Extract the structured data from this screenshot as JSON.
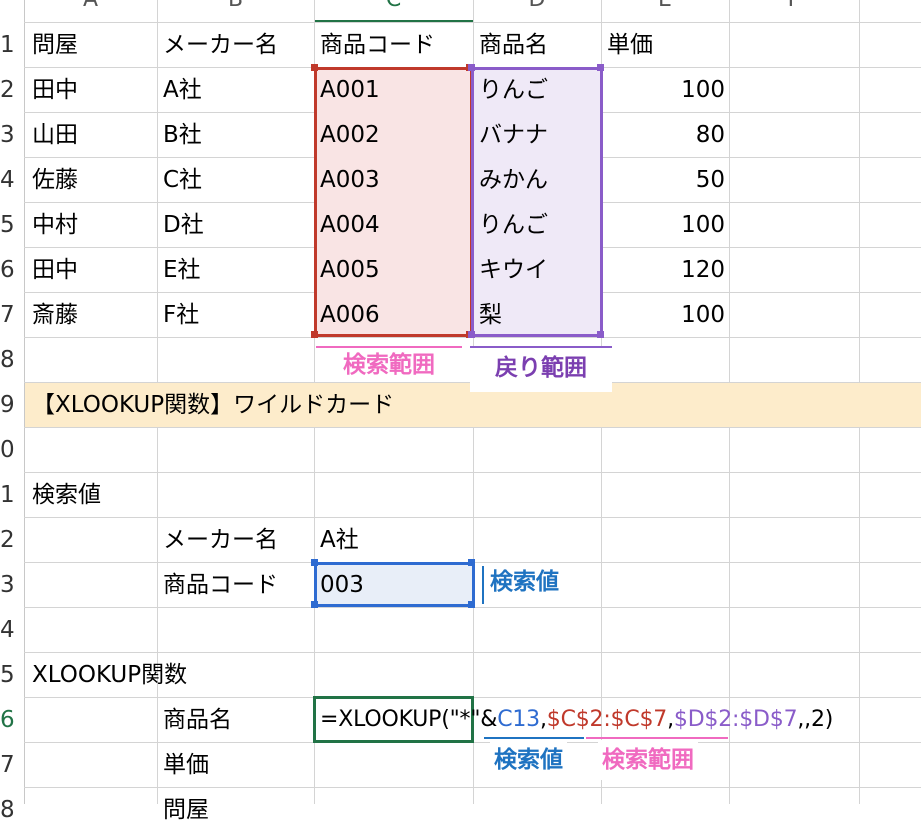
{
  "columns": [
    "A",
    "B",
    "C",
    "D",
    "E",
    "F"
  ],
  "row_numbers": [
    "1",
    "2",
    "3",
    "4",
    "5",
    "6",
    "7",
    "8",
    "9",
    "0",
    "1",
    "2",
    "3",
    "4",
    "5",
    "6",
    "7",
    "8"
  ],
  "header_row": {
    "a": "問屋",
    "b": "メーカー名",
    "c": "商品コード",
    "d": "商品名",
    "e": "単価"
  },
  "rows": [
    {
      "a": "田中",
      "b": "A社",
      "c": "A001",
      "d": "りんご",
      "e": "100"
    },
    {
      "a": "山田",
      "b": "B社",
      "c": "A002",
      "d": "バナナ",
      "e": "80"
    },
    {
      "a": "佐藤",
      "b": "C社",
      "c": "A003",
      "d": "みかん",
      "e": "50"
    },
    {
      "a": "中村",
      "b": "D社",
      "c": "A004",
      "d": "りんご",
      "e": "100"
    },
    {
      "a": "田中",
      "b": "E社",
      "c": "A005",
      "d": "キウイ",
      "e": "120"
    },
    {
      "a": "斎藤",
      "b": "F社",
      "c": "A006",
      "d": "梨",
      "e": "100"
    }
  ],
  "labels": {
    "search_range": "検索範囲",
    "return_range": "戻り範囲",
    "banner": "【XLOOKUP関数】ワイルドカード",
    "search_value_heading": "検索値",
    "maker_label": "メーカー名",
    "maker_value": "A社",
    "code_label": "商品コード",
    "code_value": "003",
    "search_value_tag": "検索値",
    "xlookup_heading": "XLOOKUP関数",
    "result_label": "商品名",
    "price_label": "単価",
    "wholesaler_label": "問屋",
    "bottom_search_value": "検索値",
    "bottom_search_range": "検索範囲"
  },
  "formula": {
    "p1": "=XLOOKUP(",
    "p2": "\"*\"&",
    "p3": "C13",
    "p4": ",",
    "p5": "$C$2:$C$7",
    "p6": ",",
    "p7": "$D$2:$D$7",
    "p8": ",,2)"
  },
  "colors": {
    "search_range_border": "#c0392b",
    "search_range_fill": "#f9e4e4",
    "return_range_border": "#8a5cc9",
    "return_range_fill": "#efe9f7",
    "search_value_border": "#2e6bd1",
    "search_value_fill": "#e8eef8",
    "banner_fill": "#fdeccb",
    "active_cell_border": "#217346",
    "label_pink": "#f06ac0",
    "label_purple": "#7b3fb0",
    "label_blue": "#1f73c1"
  }
}
